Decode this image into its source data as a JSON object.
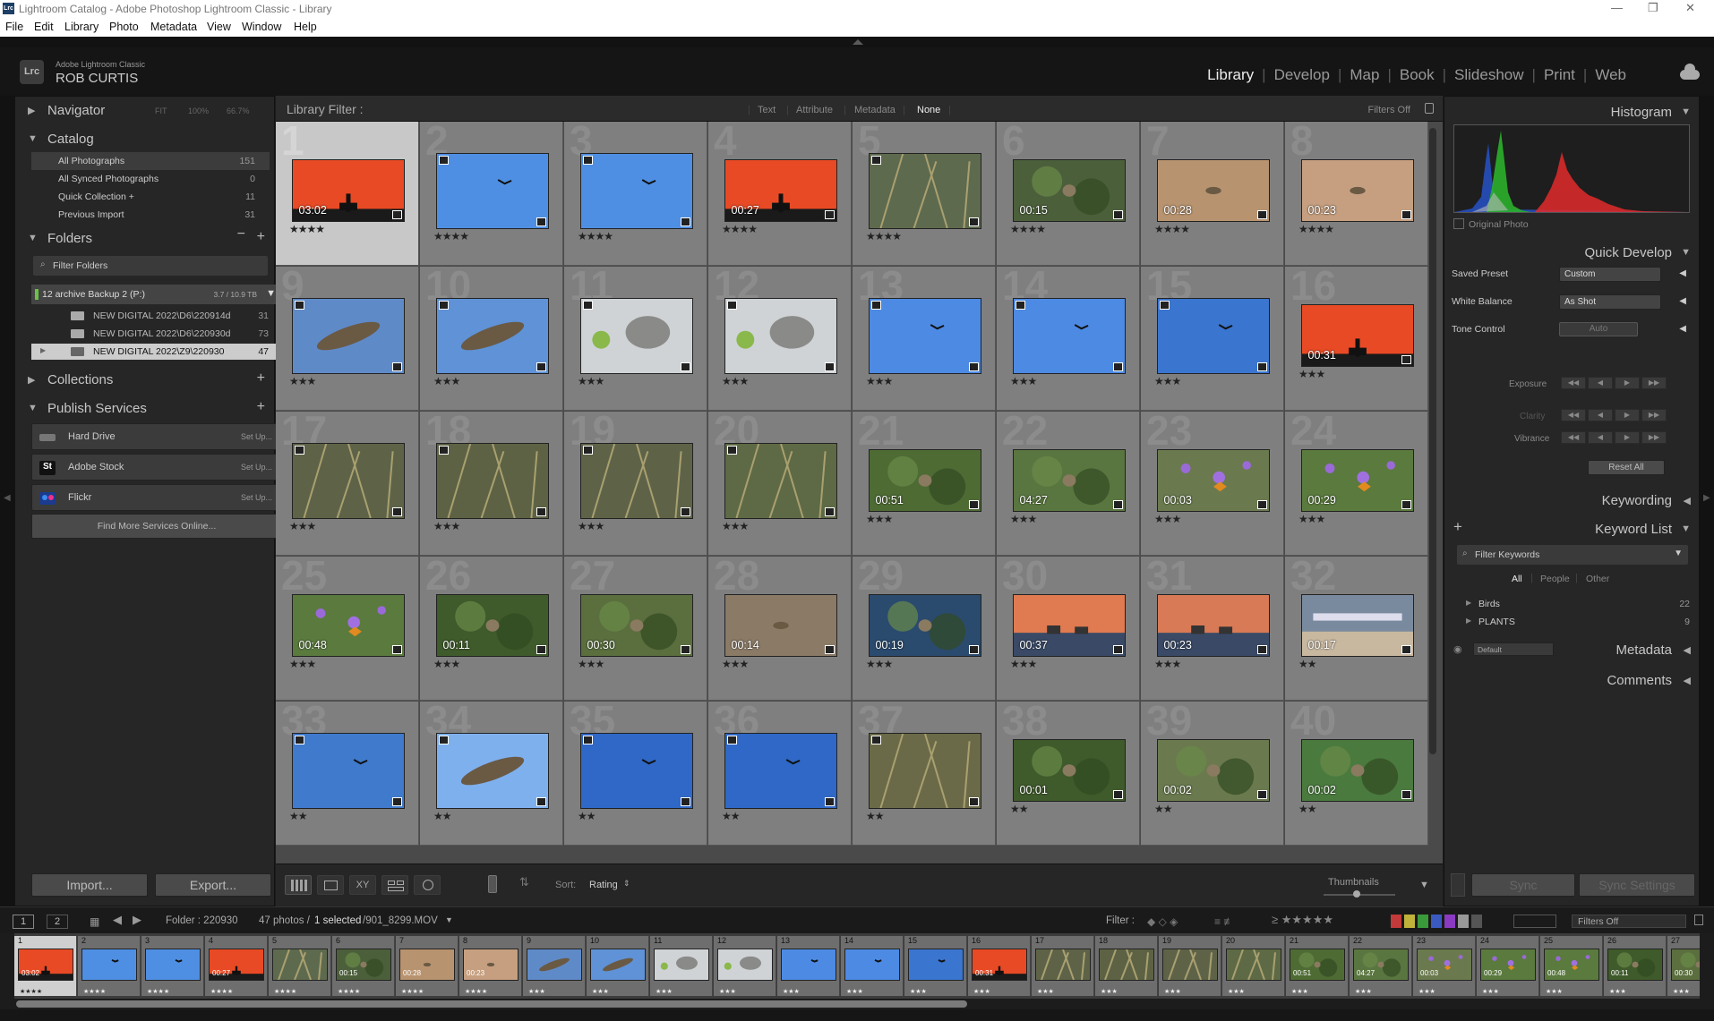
{
  "window": {
    "title": "Lightroom Catalog - Adobe Photoshop Lightroom Classic - Library",
    "logo": "Lrc",
    "controls": [
      "—",
      "❐",
      "✕"
    ]
  },
  "menu": [
    "File",
    "Edit",
    "Library",
    "Photo",
    "Metadata",
    "View",
    "Window",
    "Help"
  ],
  "identity": {
    "badge": "Lrc",
    "product": "Adobe Lightroom Classic",
    "user": "ROB CURTIS"
  },
  "modules": [
    "Library",
    "Develop",
    "Map",
    "Book",
    "Slideshow",
    "Print",
    "Web"
  ],
  "active_module": "Library",
  "left": {
    "navigator": {
      "label": "Navigator",
      "options": [
        "FIT",
        "100%",
        "66.7%"
      ]
    },
    "catalog": {
      "label": "Catalog",
      "items": [
        {
          "name": "All Photographs",
          "count": "151"
        },
        {
          "name": "All Synced Photographs",
          "count": "0"
        },
        {
          "name": "Quick Collection  +",
          "count": "11"
        },
        {
          "name": "Previous Import",
          "count": "31"
        }
      ]
    },
    "folders": {
      "label": "Folders",
      "filter_placeholder": "Filter Folders",
      "volume": {
        "name": "12 archive Backup 2 (P:)",
        "size": "3.7 / 10.9 TB"
      },
      "items": [
        {
          "name": "NEW DIGITAL 2022\\D6\\220914d",
          "count": "31"
        },
        {
          "name": "NEW DIGITAL 2022\\D6\\220930d",
          "count": "73"
        },
        {
          "name": "NEW DIGITAL 2022\\Z9\\220930",
          "count": "47"
        }
      ]
    },
    "collections": {
      "label": "Collections"
    },
    "publish": {
      "label": "Publish Services",
      "services": [
        {
          "name": "Hard Drive",
          "action": "Set Up...",
          "icon": "hard-drive-icon"
        },
        {
          "name": "Adobe Stock",
          "action": "Set Up...",
          "icon": "adobe-stock-icon",
          "glyph": "St"
        },
        {
          "name": "Flickr",
          "action": "Set Up...",
          "icon": "flickr-icon"
        }
      ],
      "find_more": "Find More Services Online..."
    },
    "import_label": "Import...",
    "export_label": "Export..."
  },
  "filterbar": {
    "label": "Library Filter :",
    "options": [
      "Text",
      "Attribute",
      "Metadata",
      "None"
    ],
    "selected": "None",
    "status": "Filters Off"
  },
  "grid": [
    {
      "n": "1",
      "dur": "03:02",
      "stars": "★★★★",
      "bg": "#e84a25",
      "kind": "sunset"
    },
    {
      "n": "2",
      "dur": "",
      "stars": "★★★★",
      "bg": "#4f8fe3",
      "kind": "sky"
    },
    {
      "n": "3",
      "dur": "",
      "stars": "★★★★",
      "bg": "#4f8fe3",
      "kind": "sky"
    },
    {
      "n": "4",
      "dur": "00:27",
      "stars": "★★★★",
      "bg": "#e84a25",
      "kind": "sunset"
    },
    {
      "n": "5",
      "dur": "",
      "stars": "★★★★",
      "bg": "#5e6a4e",
      "kind": "grass"
    },
    {
      "n": "6",
      "dur": "00:15",
      "stars": "★★★★",
      "bg": "#4c5f3b",
      "kind": "green"
    },
    {
      "n": "7",
      "dur": "00:28",
      "stars": "★★★★",
      "bg": "#b8936f",
      "kind": "dirt"
    },
    {
      "n": "8",
      "dur": "00:23",
      "stars": "★★★★",
      "bg": "#c59f7f",
      "kind": "dirt"
    },
    {
      "n": "9",
      "dur": "",
      "stars": "★★★",
      "bg": "#5f8ac8",
      "kind": "hawk"
    },
    {
      "n": "10",
      "dur": "",
      "stars": "★★★",
      "bg": "#5f92d6",
      "kind": "hawk"
    },
    {
      "n": "11",
      "dur": "",
      "stars": "★★★",
      "bg": "#cfd3d6",
      "kind": "squirrel"
    },
    {
      "n": "12",
      "dur": "",
      "stars": "★★★",
      "bg": "#cfd3d6",
      "kind": "squirrel"
    },
    {
      "n": "13",
      "dur": "",
      "stars": "★★★",
      "bg": "#4d8ae3",
      "kind": "sky"
    },
    {
      "n": "14",
      "dur": "",
      "stars": "★★★",
      "bg": "#4d8ae3",
      "kind": "sky"
    },
    {
      "n": "15",
      "dur": "",
      "stars": "★★★",
      "bg": "#3a75cf",
      "kind": "sky"
    },
    {
      "n": "16",
      "dur": "00:31",
      "stars": "★★★",
      "bg": "#e84a25",
      "kind": "sunset"
    },
    {
      "n": "17",
      "dur": "",
      "stars": "★★★",
      "bg": "#5e6348",
      "kind": "grass"
    },
    {
      "n": "18",
      "dur": "",
      "stars": "★★★",
      "bg": "#5d6244",
      "kind": "grass"
    },
    {
      "n": "19",
      "dur": "",
      "stars": "★★★",
      "bg": "#5e6348",
      "kind": "grass"
    },
    {
      "n": "20",
      "dur": "",
      "stars": "★★★",
      "bg": "#5e6a45",
      "kind": "grass"
    },
    {
      "n": "21",
      "dur": "00:51",
      "stars": "★★★",
      "bg": "#4e6b34",
      "kind": "green"
    },
    {
      "n": "22",
      "dur": "04:27",
      "stars": "★★★",
      "bg": "#5a7640",
      "kind": "green"
    },
    {
      "n": "23",
      "dur": "00:03",
      "stars": "★★★",
      "bg": "#6a7a4e",
      "kind": "flowers"
    },
    {
      "n": "24",
      "dur": "00:29",
      "stars": "★★★",
      "bg": "#5a7a3e",
      "kind": "flowers"
    },
    {
      "n": "25",
      "dur": "00:48",
      "stars": "★★★",
      "bg": "#5a7a3e",
      "kind": "flowers"
    },
    {
      "n": "26",
      "dur": "00:11",
      "stars": "★★★",
      "bg": "#3f5a2b",
      "kind": "green"
    },
    {
      "n": "27",
      "dur": "00:30",
      "stars": "★★★",
      "bg": "#5a6e3e",
      "kind": "green"
    },
    {
      "n": "28",
      "dur": "00:14",
      "stars": "★★★",
      "bg": "#8a7a66",
      "kind": "dirt"
    },
    {
      "n": "29",
      "dur": "00:19",
      "stars": "★★★",
      "bg": "#2a4a6e",
      "kind": "green"
    },
    {
      "n": "30",
      "dur": "00:37",
      "stars": "★★★",
      "bg": "#e07a50",
      "kind": "ships"
    },
    {
      "n": "31",
      "dur": "00:23",
      "stars": "★★★",
      "bg": "#d87a55",
      "kind": "ships"
    },
    {
      "n": "32",
      "dur": "00:17",
      "stars": "★★",
      "bg": "#7a8a9e",
      "kind": "beach"
    },
    {
      "n": "33",
      "dur": "",
      "stars": "★★",
      "bg": "#3f7acc",
      "kind": "sky"
    },
    {
      "n": "34",
      "dur": "",
      "stars": "★★",
      "bg": "#7fb0ee",
      "kind": "hawk"
    },
    {
      "n": "35",
      "dur": "",
      "stars": "★★",
      "bg": "#2f68c6",
      "kind": "sky"
    },
    {
      "n": "36",
      "dur": "",
      "stars": "★★",
      "bg": "#2f68c6",
      "kind": "sky"
    },
    {
      "n": "37",
      "dur": "",
      "stars": "★★",
      "bg": "#6b6a48",
      "kind": "grass"
    },
    {
      "n": "38",
      "dur": "00:01",
      "stars": "★★",
      "bg": "#3f5a2b",
      "kind": "green"
    },
    {
      "n": "39",
      "dur": "00:02",
      "stars": "★★",
      "bg": "#6a7a4e",
      "kind": "green"
    },
    {
      "n": "40",
      "dur": "00:02",
      "stars": "★★",
      "bg": "#4a7a3e",
      "kind": "green"
    }
  ],
  "toolbar": {
    "sort_label": "Sort:",
    "sort_value": "Rating",
    "thumbnails_label": "Thumbnails",
    "sync_label": "Sync",
    "sync_settings_label": "Sync Settings"
  },
  "status": {
    "folder": "Folder : 220930",
    "count": "47 photos /",
    "selected": "1 selected",
    "file": "/901_8299.MOV",
    "filter_label": "Filter :",
    "filters_off": "Filters Off",
    "page1": "1",
    "page2": "2"
  },
  "filmstrip_count": 27,
  "right": {
    "histogram": {
      "label": "Histogram",
      "original_photo": "Original Photo"
    },
    "quick_develop": {
      "label": "Quick Develop",
      "saved_preset": {
        "label": "Saved Preset",
        "value": "Custom"
      },
      "white_balance": {
        "label": "White Balance",
        "value": "As Shot"
      },
      "tone_control": {
        "label": "Tone Control",
        "value": "Auto"
      },
      "exposure": "Exposure",
      "clarity": "Clarity",
      "vibrance": "Vibrance",
      "reset_all": "Reset All"
    },
    "keywording": "Keywording",
    "keyword_list": {
      "label": "Keyword List",
      "filter_placeholder": "Filter Keywords",
      "tabs": [
        "All",
        "People",
        "Other"
      ],
      "items": [
        {
          "name": "Birds",
          "count": "22"
        },
        {
          "name": "PLANTS",
          "count": "9"
        }
      ]
    },
    "metadata": {
      "label": "Metadata",
      "preset": "Default"
    },
    "comments": "Comments"
  },
  "colors": {
    "accent_text": "#ececec",
    "panel_bg": "#262626",
    "grid_bg": "#7f7f7f",
    "selected_cell": "#c8c8c8"
  }
}
